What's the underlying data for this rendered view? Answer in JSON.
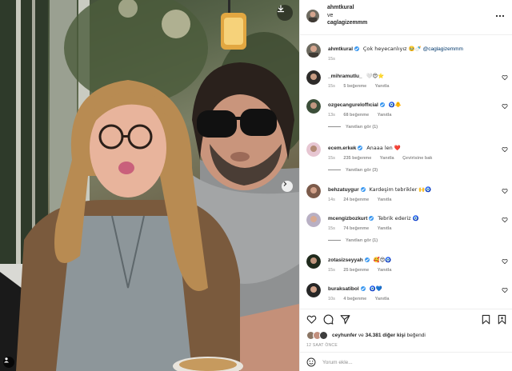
{
  "post": {
    "header": {
      "author": "ahmtkural",
      "conjunction": "ve",
      "coauthor": "caglagizemmm",
      "more_icon": "more-horizontal-icon"
    },
    "caption": {
      "user": "ahmtkural",
      "text": "Çok heyecanlıyız 🥹🍼",
      "mention": "@caglagizemmm",
      "time": "15s"
    },
    "comments": [
      {
        "user": "_mihramutlu_",
        "verified": false,
        "text": "🤍😍⭐",
        "time": "15s",
        "likes": "5 beğenme",
        "reply": "Yanıtla",
        "see_translation": "",
        "replies": ""
      },
      {
        "user": "ozgecangureloffıcial",
        "verified": true,
        "text": "🧿🐥",
        "time": "13s",
        "likes": "68 beğenme",
        "reply": "Yanıtla",
        "see_translation": "",
        "replies": "Yanıtları gör (1)"
      },
      {
        "user": "ecem.erkek",
        "verified": true,
        "text": "Anaaa len ❤️",
        "time": "15s",
        "likes": "235 beğenme",
        "reply": "Yanıtla",
        "see_translation": "Çevirisine bak",
        "replies": "Yanıtları gör (3)"
      },
      {
        "user": "behzatuygur",
        "verified": true,
        "text": "Kardeşim tebrikler 🙌🧿",
        "time": "14s",
        "likes": "24 beğenme",
        "reply": "Yanıtla",
        "see_translation": "",
        "replies": ""
      },
      {
        "user": "mcengizbozkurt",
        "verified": true,
        "text": "Tebrik ederiz 🧿",
        "time": "15s",
        "likes": "74 beğenme",
        "reply": "Yanıtla",
        "see_translation": "",
        "replies": "Yanıtları gör (1)"
      },
      {
        "user": "zotasizseyyah",
        "verified": true,
        "text": "🥰😍🧿",
        "time": "15s",
        "likes": "25 beğenme",
        "reply": "Yanıtla",
        "see_translation": "",
        "replies": ""
      },
      {
        "user": "buraksatibol",
        "verified": true,
        "text": "🧿💙",
        "time": "10s",
        "likes": "4 beğenme",
        "reply": "Yanıtla",
        "see_translation": "",
        "replies": ""
      }
    ],
    "actions": [
      "heart-icon",
      "comment-icon",
      "share-icon",
      "bookmark-icon"
    ],
    "likes": {
      "first_user": "ceyhunfer",
      "joiner": "ve",
      "count_text": "34.381 diğer kişi",
      "suffix": "beğendi"
    },
    "timestamp": "12 SAAT ÖNCE",
    "add_comment": {
      "placeholder": "Yorum ekle...",
      "emoji_icon": "smile-icon"
    }
  },
  "photo_controls": {
    "download_icon": "download-icon",
    "next_icon": "chevron-right-icon",
    "tag_icon": "user-tag-icon"
  },
  "colors": {
    "link": "#00376b",
    "verified": "#3897f0",
    "meta": "#8e8e8e",
    "heart_red": "#ed4956"
  }
}
